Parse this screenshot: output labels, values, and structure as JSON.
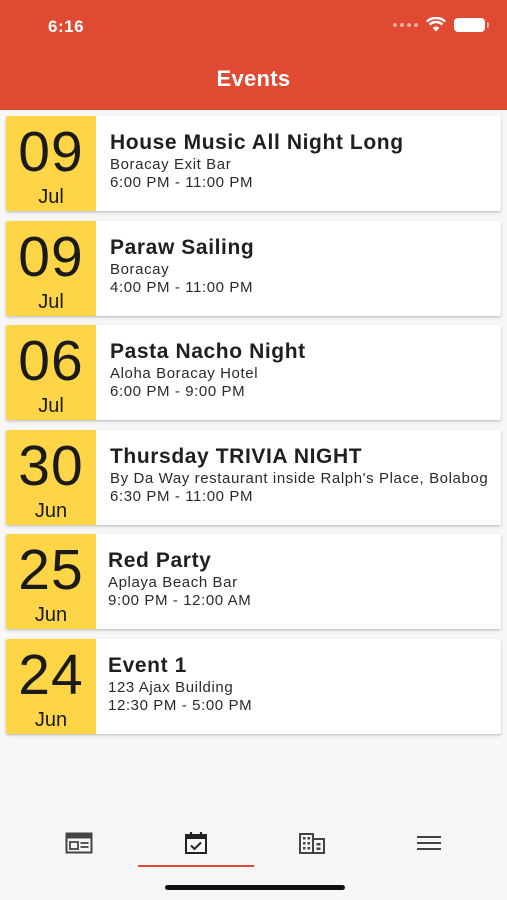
{
  "status_bar": {
    "time": "6:16"
  },
  "header": {
    "title": "Events"
  },
  "events": [
    {
      "day": "09",
      "month": "Jul",
      "name": "House Music All Night Long",
      "venue": "Boracay Exit Bar",
      "hours": "6:00 PM - 11:00 PM"
    },
    {
      "day": "09",
      "month": "Jul",
      "name": "Paraw Sailing",
      "venue": "Boracay",
      "hours": "4:00 PM - 11:00 PM"
    },
    {
      "day": "06",
      "month": "Jul",
      "name": "Pasta Nacho Night",
      "venue": "Aloha Boracay Hotel",
      "hours": "6:00 PM - 9:00 PM"
    },
    {
      "day": "30",
      "month": "Jun",
      "name": "Thursday TRIVIA NIGHT",
      "venue": "By Da Way restaurant inside Ralph's Place, Bolabog",
      "hours": "6:30 PM - 11:00 PM"
    },
    {
      "day": "25",
      "month": "Jun",
      "name": "Red Party",
      "venue": "Aplaya Beach Bar",
      "hours": "9:00 PM - 12:00 AM"
    },
    {
      "day": "24",
      "month": "Jun",
      "name": "Event 1",
      "venue": "123 Ajax Building",
      "hours": "12:30 PM - 5:00 PM"
    }
  ],
  "tabs": [
    {
      "icon": "news-icon",
      "active": false
    },
    {
      "icon": "calendar-check-icon",
      "active": true
    },
    {
      "icon": "business-directory-icon",
      "active": false
    },
    {
      "icon": "menu-icon",
      "active": false
    }
  ],
  "colors": {
    "accent": "#e04a33",
    "date_badge": "#fdd546",
    "background": "#f7f7f7"
  }
}
